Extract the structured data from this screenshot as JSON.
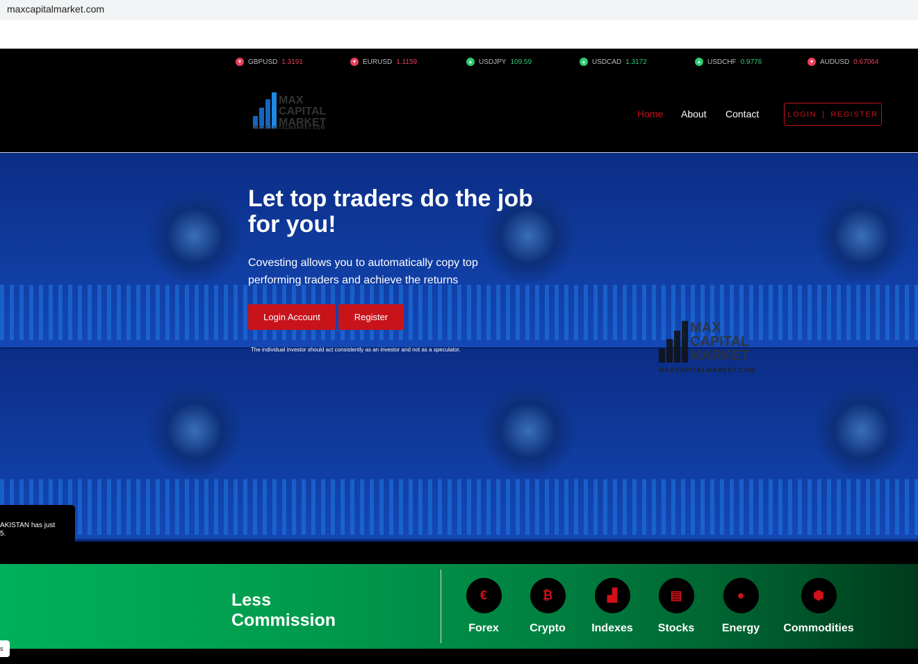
{
  "browser": {
    "url": "maxcapitalmarket.com"
  },
  "ticker": [
    {
      "symbol": "GBPUSD",
      "value": "1.3191",
      "dir": "down",
      "color": "#e8405a"
    },
    {
      "symbol": "EURUSD",
      "value": "1.1159",
      "dir": "down",
      "color": "#e8405a"
    },
    {
      "symbol": "USDJPY",
      "value": "109.59",
      "dir": "up",
      "color": "#2ecc71"
    },
    {
      "symbol": "USDCAD",
      "value": "1.3172",
      "dir": "up",
      "color": "#2ecc71"
    },
    {
      "symbol": "USDCHF",
      "value": "0.9776",
      "dir": "up",
      "color": "#2ecc71"
    },
    {
      "symbol": "AUDUSD",
      "value": "0.67064",
      "dir": "down",
      "color": "#e8405a"
    }
  ],
  "logo": {
    "line1": "MAX",
    "line2": "CAPITAL",
    "line3": "MARKET",
    "sub": "MAXCAPITALMARKET.COM"
  },
  "nav": {
    "home": "Home",
    "about": "About",
    "contact": "Contact",
    "login": "LOGIN",
    "sep": "|",
    "register": "REGISTER"
  },
  "hero": {
    "title": "Let top traders do the job for you!",
    "text": "Covesting allows you to automatically copy top performing traders and achieve the returns",
    "login_btn": "Login Account",
    "register_btn": "Register",
    "disclaimer": "The individual investor should act consistently as an investor and not as a speculator."
  },
  "toast": {
    "line1": "AKISTAN has just",
    "line2": "5."
  },
  "cookie": {
    "text": "s"
  },
  "features": {
    "title_line1": "Less",
    "title_line2": "Commission",
    "categories": [
      {
        "label": "Forex",
        "icon": "euro-icon",
        "glyph": "€"
      },
      {
        "label": "Crypto",
        "icon": "bitcoin-icon",
        "glyph": "₿"
      },
      {
        "label": "Indexes",
        "icon": "area-chart-icon",
        "glyph": "▟"
      },
      {
        "label": "Stocks",
        "icon": "document-icon",
        "glyph": "▤"
      },
      {
        "label": "Energy",
        "icon": "drop-icon",
        "glyph": "●"
      },
      {
        "label": "Commodities",
        "icon": "box-icon",
        "glyph": "⬢"
      }
    ]
  },
  "colors": {
    "accent": "#c8131b",
    "green": "#00a651"
  }
}
